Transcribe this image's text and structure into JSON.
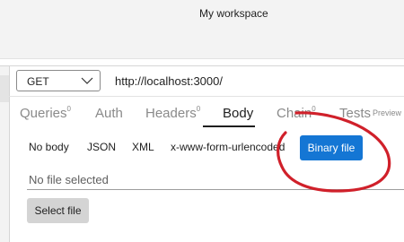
{
  "window": {
    "title": "My workspace"
  },
  "request": {
    "method": "GET",
    "url": "http://localhost:3000/"
  },
  "tabs": {
    "queries": {
      "label": "Queries",
      "count": "0"
    },
    "auth": {
      "label": "Auth"
    },
    "headers": {
      "label": "Headers",
      "count": "0"
    },
    "body": {
      "label": "Body"
    },
    "chain": {
      "label": "Chain",
      "count": "0"
    },
    "tests": {
      "label": "Tests",
      "badge": "Preview"
    }
  },
  "body_types": {
    "no_body": "No body",
    "json": "JSON",
    "xml": "XML",
    "form": "x-www-form-urlencoded",
    "binary": "Binary file"
  },
  "binary": {
    "placeholder": "No file selected",
    "select_label": "Select file"
  },
  "colors": {
    "accent": "#1476d4",
    "annotation": "#d0202a"
  }
}
